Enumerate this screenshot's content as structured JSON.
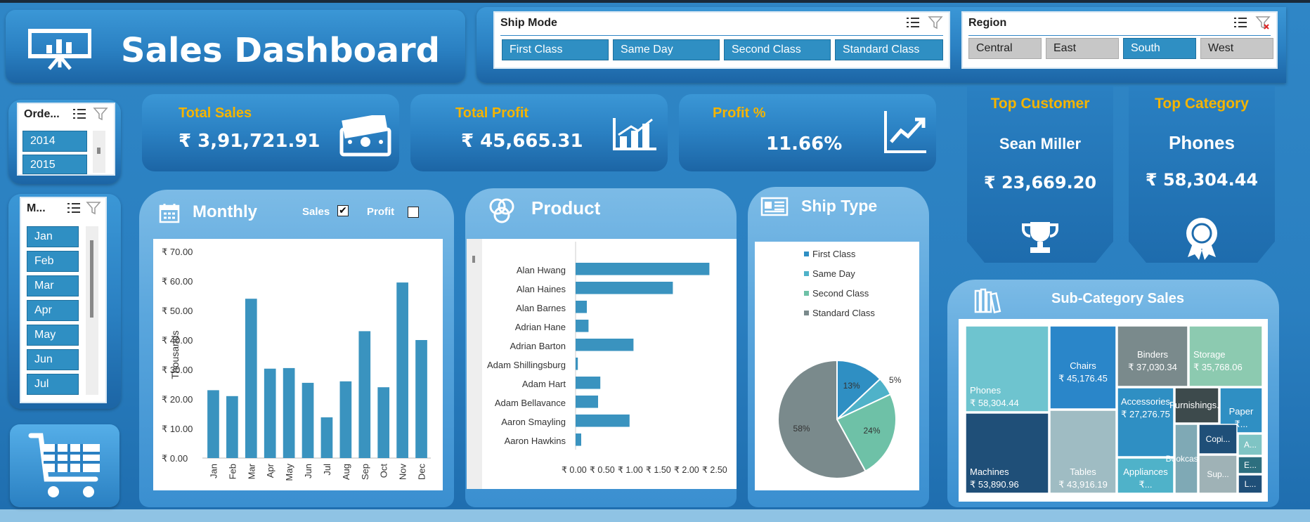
{
  "header": {
    "title": "Sales Dashboard"
  },
  "ship_mode_slicer": {
    "title": "Ship Mode",
    "options": [
      "First Class",
      "Same Day",
      "Second Class",
      "Standard Class"
    ]
  },
  "region_slicer": {
    "title": "Region",
    "options": [
      "Central",
      "East",
      "South",
      "West"
    ],
    "selected": "South"
  },
  "order_slicer": {
    "title": "Orde...",
    "options": [
      "2014",
      "2015"
    ]
  },
  "month_slicer": {
    "title": "M...",
    "options": [
      "Jan",
      "Feb",
      "Mar",
      "Apr",
      "May",
      "Jun",
      "Jul"
    ]
  },
  "kpis": {
    "total_sales_label": "Total Sales",
    "total_sales_value": "₹ 3,91,721.91",
    "total_profit_label": "Total Profit",
    "total_profit_value": "₹ 45,665.31",
    "profit_pct_label": "Profit %",
    "profit_pct_value": "11.66%"
  },
  "top_customer": {
    "label": "Top Customer",
    "name": "Sean Miller",
    "value": "₹ 23,669.20"
  },
  "top_category": {
    "label": "Top Category",
    "name": "Phones",
    "value": "₹ 58,304.44"
  },
  "monthly": {
    "title": "Monthly",
    "sales_label": "Sales",
    "profit_label": "Profit",
    "sales_checked": true,
    "profit_checked": false
  },
  "product": {
    "title": "Product"
  },
  "ship_type": {
    "title": "Ship Type"
  },
  "subcategory": {
    "title": "Sub-Category Sales"
  },
  "chart_data": [
    {
      "type": "bar",
      "title": "Monthly",
      "ylabel": "Thousands",
      "categories": [
        "Jan",
        "Feb",
        "Mar",
        "Apr",
        "May",
        "Jun",
        "Jul",
        "Aug",
        "Sep",
        "Oct",
        "Nov",
        "Dec"
      ],
      "values": [
        23,
        21,
        54,
        30.3,
        30.5,
        25.5,
        13.8,
        26,
        43,
        24,
        59.5,
        40
      ],
      "ylim": [
        0,
        70
      ],
      "yticks": [
        "₹ 0.00",
        "₹ 10.00",
        "₹ 20.00",
        "₹ 30.00",
        "₹ 40.00",
        "₹ 50.00",
        "₹ 60.00",
        "₹ 70.00"
      ],
      "color": "#3a93bf"
    },
    {
      "type": "bar",
      "orientation": "horizontal",
      "title": "Product",
      "categories": [
        "Alan Hwang",
        "Alan Haines",
        "Alan Barnes",
        "Adrian Hane",
        "Adrian Barton",
        "Adam Shillingsburg",
        "Adam Hart",
        "Adam Bellavance",
        "Aaron Smayling",
        "Aaron Hawkins"
      ],
      "values": [
        2.38,
        1.73,
        0.2,
        0.23,
        1.03,
        0.04,
        0.44,
        0.4,
        0.96,
        0.1
      ],
      "xlim": [
        0,
        2.5
      ],
      "xticks": [
        "₹ 0.00",
        "₹ 0.50",
        "₹ 1.00",
        "₹ 1.50",
        "₹ 2.00",
        "₹ 2.50"
      ],
      "color": "#3a93bf"
    },
    {
      "type": "pie",
      "title": "Ship Type",
      "labels": [
        "First Class",
        "Same Day",
        "Second Class",
        "Standard Class"
      ],
      "values": [
        13,
        5,
        24,
        58
      ],
      "colors": [
        "#2f8fc3",
        "#4fb2c9",
        "#6ec1a7",
        "#7a8a8c"
      ]
    },
    {
      "type": "heatmap",
      "title": "Sub-Category Sales",
      "items": [
        {
          "label": "Phones",
          "value": "₹ 58,304.44",
          "color": "#6ec4cf"
        },
        {
          "label": "Machines",
          "value": "₹ 53,890.96",
          "color": "#1f4f78"
        },
        {
          "label": "Chairs",
          "value": "₹ 45,176.45",
          "color": "#2a86c9"
        },
        {
          "label": "Tables",
          "value": "₹ 43,916.19",
          "color": "#9fbcc3"
        },
        {
          "label": "Binders",
          "value": "₹ 37,030.34",
          "color": "#7a8a8c"
        },
        {
          "label": "Storage",
          "value": "₹ 35,768.06",
          "color": "#8ccab0"
        },
        {
          "label": "Accessories",
          "value": "₹ 27,276.75",
          "color": "#2f8fc3"
        },
        {
          "label": "Appliances",
          "value": "₹...",
          "color": "#4fb2c9"
        },
        {
          "label": "Furnishings...",
          "value": "",
          "color": "#3d4a4c"
        },
        {
          "label": "Paper",
          "value": "₹...",
          "color": "#2f8fc3"
        },
        {
          "label": "Bookcases",
          "value": "",
          "color": "#7fa9b5"
        },
        {
          "label": "Copi...",
          "value": "",
          "color": "#1f4f78"
        },
        {
          "label": "Sup...",
          "value": "",
          "color": "#9fb2b6"
        },
        {
          "label": "A...",
          "value": "",
          "color": "#7fc4c4"
        },
        {
          "label": "E...",
          "value": "",
          "color": "#2d6f7f"
        },
        {
          "label": "L...",
          "value": "",
          "color": "#1f4f78"
        }
      ]
    }
  ]
}
